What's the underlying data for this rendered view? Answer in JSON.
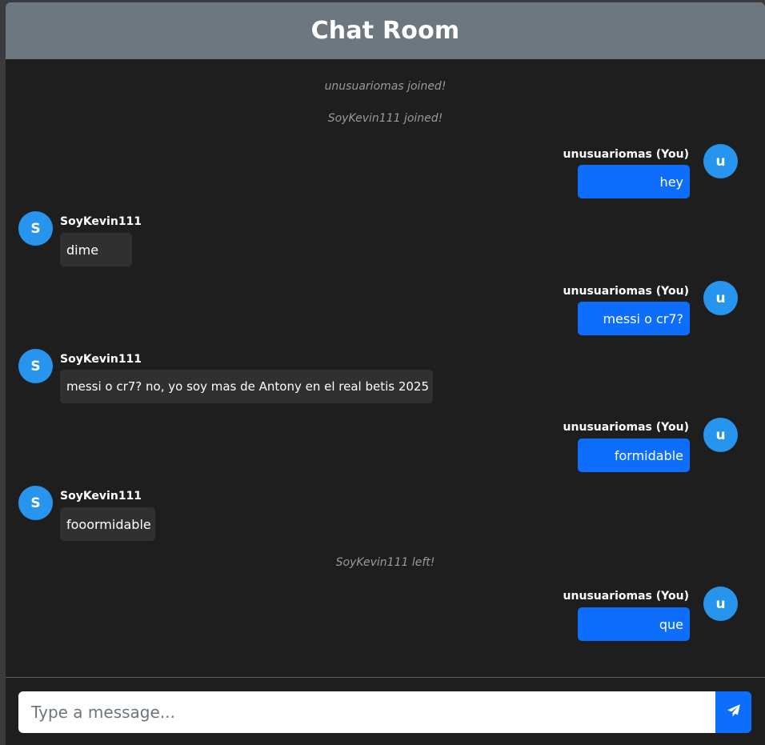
{
  "header": {
    "title": "Chat Room"
  },
  "events": [
    {
      "text": "unusuariomas joined!"
    },
    {
      "text": "SoyKevin111 joined!"
    },
    {
      "text": "SoyKevin111 left!"
    }
  ],
  "messages": [
    {
      "sender": "unusuariomas (You)",
      "initial": "u",
      "text": "hey",
      "mine": true
    },
    {
      "sender": "SoyKevin111",
      "initial": "S",
      "text": "dime",
      "mine": false
    },
    {
      "sender": "unusuariomas (You)",
      "initial": "u",
      "text": "messi o cr7?",
      "mine": true
    },
    {
      "sender": "SoyKevin111",
      "initial": "S",
      "text": "messi o cr7? no, yo soy mas de Antony en el real betis 2025",
      "mine": false
    },
    {
      "sender": "unusuariomas (You)",
      "initial": "u",
      "text": "formidable",
      "mine": true
    },
    {
      "sender": "SoyKevin111",
      "initial": "S",
      "text": "fooormidable",
      "mine": false
    },
    {
      "sender": "unusuariomas (You)",
      "initial": "u",
      "text": "que",
      "mine": true
    }
  ],
  "composer": {
    "placeholder": "Type a message...",
    "send_icon": "paper-plane-icon"
  },
  "colors": {
    "header_bg": "#6d7780",
    "chat_bg": "#1e1e1f",
    "my_bubble": "#0d6efd",
    "their_bubble": "#303031",
    "avatar": "#2795ee"
  }
}
